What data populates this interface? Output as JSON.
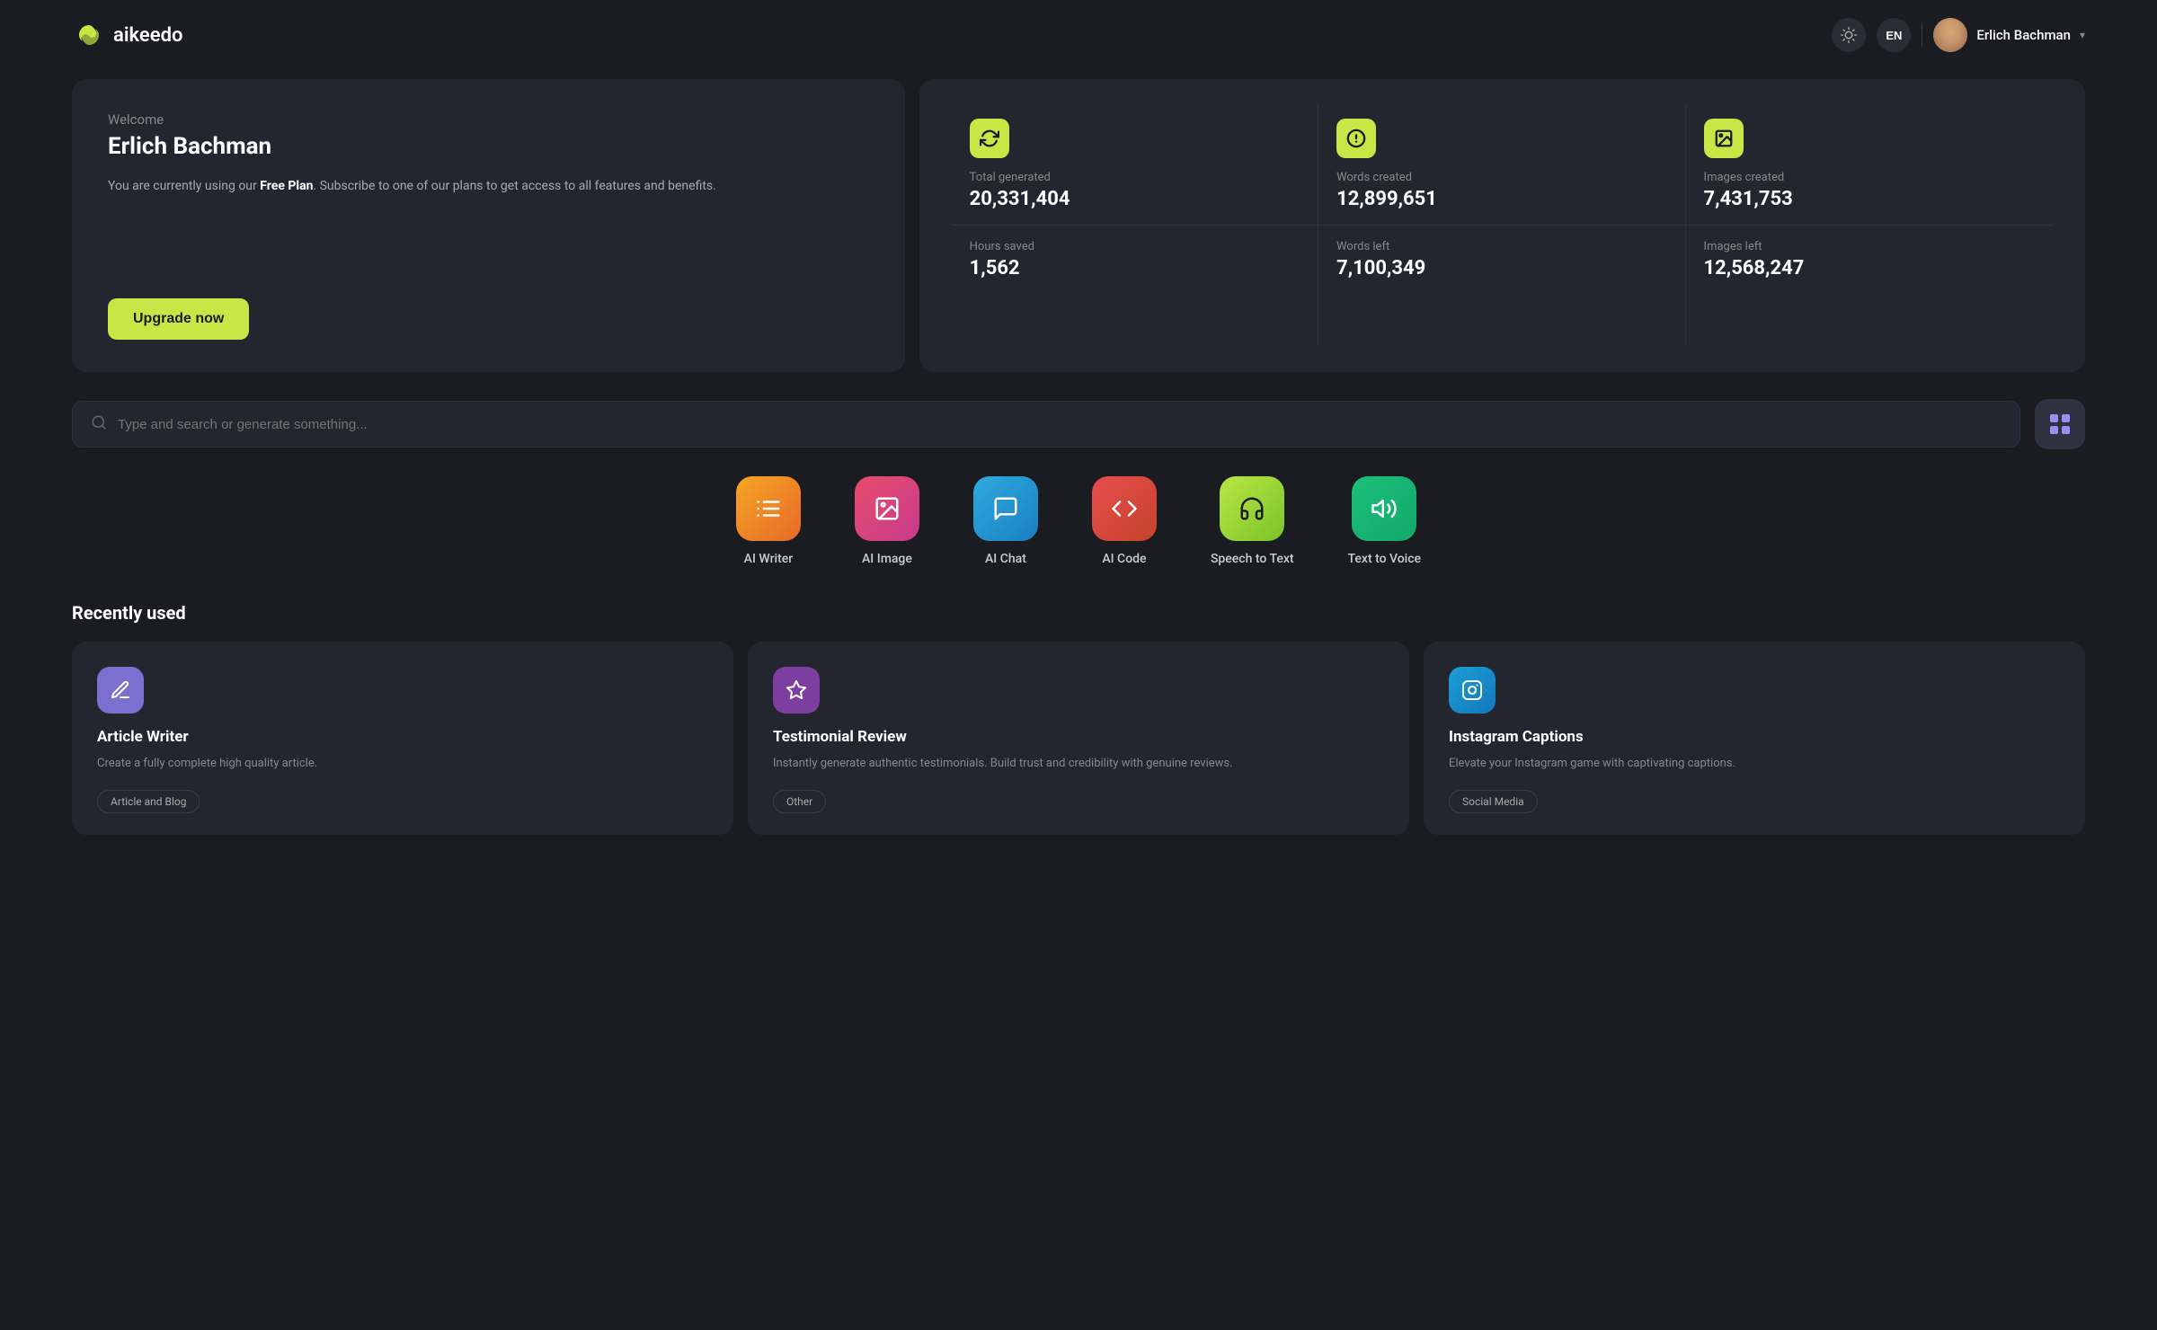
{
  "header": {
    "logo_text": "aikeedo",
    "lang": "EN",
    "user_name": "Erlich Bachman"
  },
  "stats": {
    "total_generated_label": "Total generated",
    "total_generated_value": "20,331,404",
    "words_created_label": "Words created",
    "words_created_value": "12,899,651",
    "images_created_label": "Images created",
    "images_created_value": "7,431,753",
    "hours_saved_label": "Hours saved",
    "hours_saved_value": "1,562",
    "words_left_label": "Words left",
    "words_left_value": "7,100,349",
    "images_left_label": "Images left",
    "images_left_value": "12,568,247"
  },
  "welcome": {
    "label": "Welcome",
    "name": "Erlich Bachman",
    "desc_before": "You are currently using our ",
    "desc_bold": "Free Plan",
    "desc_after": ". Subscribe to one of our plans to get access to all features and benefits.",
    "upgrade_btn": "Upgrade now"
  },
  "search": {
    "placeholder": "Type and search or generate something..."
  },
  "tools": [
    {
      "id": "writer",
      "label": "AI Writer",
      "icon_class": "icon-writer"
    },
    {
      "id": "image",
      "label": "AI Image",
      "icon_class": "icon-image"
    },
    {
      "id": "chat",
      "label": "AI Chat",
      "icon_class": "icon-chat"
    },
    {
      "id": "code",
      "label": "AI Code",
      "icon_class": "icon-code"
    },
    {
      "id": "speech",
      "label": "Speech to Text",
      "icon_class": "icon-speech"
    },
    {
      "id": "voice",
      "label": "Text to Voice",
      "icon_class": "icon-voice"
    }
  ],
  "recently_used": {
    "title": "Recently used",
    "cards": [
      {
        "id": "article-writer",
        "icon_class": "icon-article",
        "title": "Article Writer",
        "desc": "Create a fully complete high quality article.",
        "tag": "Article and Blog"
      },
      {
        "id": "testimonial-review",
        "icon_class": "icon-testimonial",
        "title": "Testimonial Review",
        "desc": "Instantly generate authentic testimonials. Build trust and credibility with genuine reviews.",
        "tag": "Other"
      },
      {
        "id": "instagram-captions",
        "icon_class": "icon-instagram",
        "title": "Instagram Captions",
        "desc": "Elevate your Instagram game with captivating captions.",
        "tag": "Social Media"
      }
    ]
  }
}
